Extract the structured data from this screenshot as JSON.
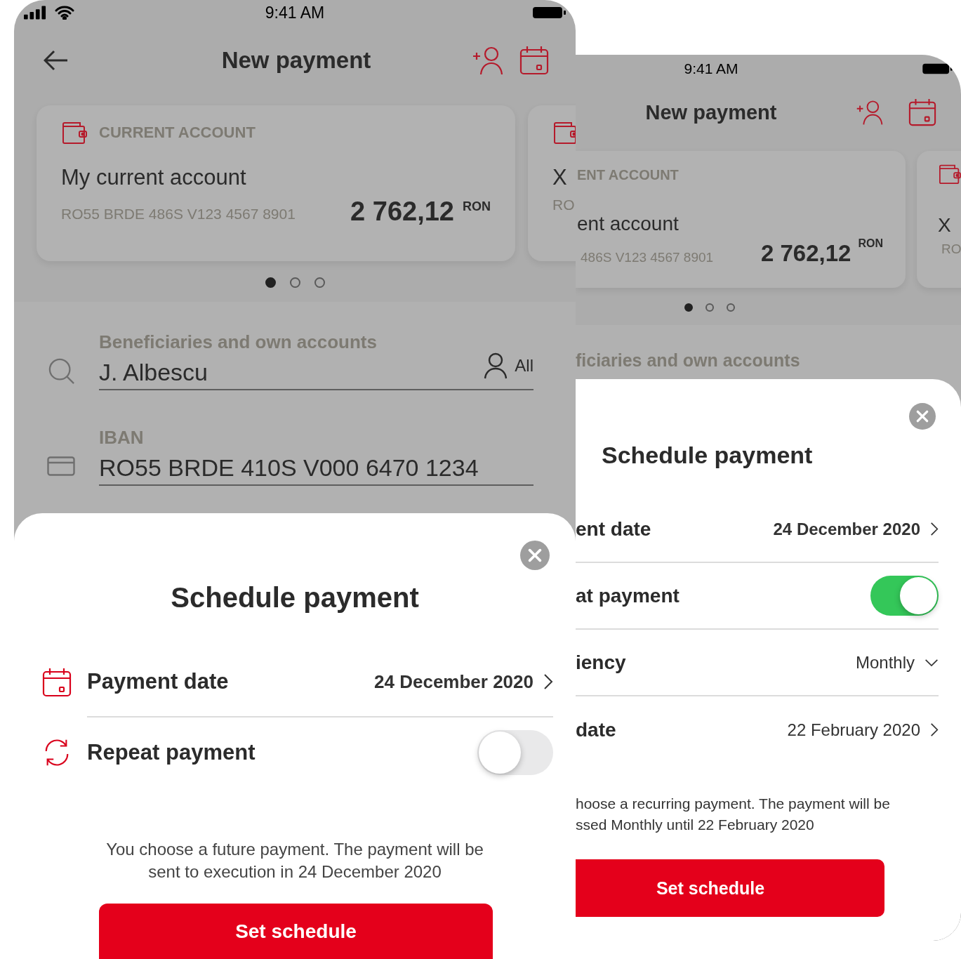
{
  "front_phone": {
    "status_bar": {
      "time": "9:41 AM"
    },
    "header": {
      "title": "New payment"
    },
    "accounts": [
      {
        "type_label": "CURRENT ACCOUNT",
        "name": "My current account",
        "iban": "RO55 BRDE 486S V123 4567 8901",
        "amount": "2 762,12",
        "currency": "RON"
      },
      {
        "name": "X",
        "iban": "RO"
      }
    ],
    "pager": [
      {
        "selected": true
      },
      {
        "selected": false
      },
      {
        "selected": false
      }
    ],
    "fields": [
      {
        "kind": "search",
        "label": "Beneficiaries and own accounts",
        "value": "J. Albescu",
        "filter": "All"
      },
      {
        "kind": "iban",
        "label": "IBAN",
        "value": "RO55 BRDE 410S V000 6470 1234"
      }
    ],
    "sheet": {
      "title": "Schedule payment",
      "rows": [
        {
          "kind": "date",
          "label": "Payment date",
          "value": "24 December 2020",
          "emphasized": true
        },
        {
          "kind": "toggle",
          "label": "Repeat payment",
          "on": false
        }
      ],
      "note": "You choose a future payment. The payment will be sent to execution in 24 December 2020",
      "button": "Set schedule"
    }
  },
  "back_phone": {
    "status_bar": {
      "time": "9:41 AM"
    },
    "header": {
      "title": "New payment"
    },
    "accounts": [
      {
        "type_label": "ENT ACCOUNT",
        "name": "ent account",
        "iban": "486S V123 4567 8901",
        "amount": "2 762,12",
        "currency": "RON"
      },
      {
        "name": "X",
        "iban": "RO"
      }
    ],
    "pager": [
      {
        "selected": true
      },
      {
        "selected": false
      },
      {
        "selected": false
      }
    ],
    "field_label": "ficiaries and own accounts",
    "sheet": {
      "title": "Schedule payment",
      "rows": [
        {
          "kind": "date",
          "label": "ent date",
          "value": "24 December 2020",
          "emphasized": true
        },
        {
          "kind": "toggle",
          "label": "at payment",
          "on": true
        },
        {
          "kind": "select",
          "label": "iency",
          "value": "Monthly",
          "emphasized": false
        },
        {
          "kind": "date",
          "label": "date",
          "value": "22 February 2020",
          "emphasized": false
        }
      ],
      "note_lines": [
        "hoose a recurring payment. The payment will be",
        "ssed Monthly until 22 February 2020"
      ],
      "button": "Set schedule"
    }
  }
}
